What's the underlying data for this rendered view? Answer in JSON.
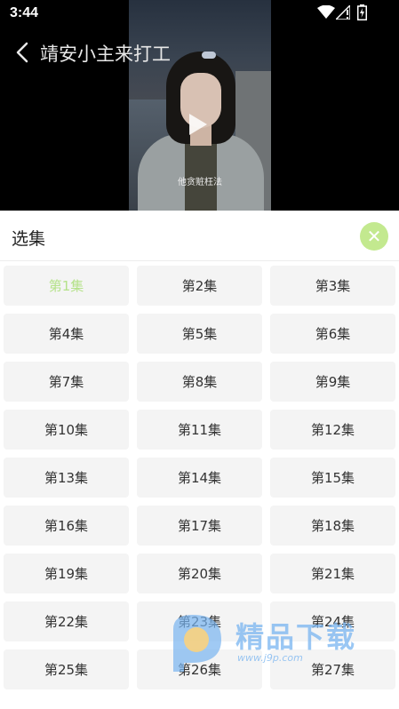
{
  "status_bar": {
    "time": "3:44"
  },
  "header": {
    "title": "靖安小主来打工"
  },
  "video": {
    "subtitle": "他贪赃枉法"
  },
  "panel": {
    "title": "选集",
    "close_symbol": "✕",
    "active_index": 0,
    "episodes": [
      "第1集",
      "第2集",
      "第3集",
      "第4集",
      "第5集",
      "第6集",
      "第7集",
      "第8集",
      "第9集",
      "第10集",
      "第11集",
      "第12集",
      "第13集",
      "第14集",
      "第15集",
      "第16集",
      "第17集",
      "第18集",
      "第19集",
      "第20集",
      "第21集",
      "第22集",
      "第23集",
      "第24集",
      "第25集",
      "第26集",
      "第27集"
    ]
  },
  "watermark": {
    "text": "精品下载",
    "url": "www.j9p.com"
  },
  "colors": {
    "accent": "#b5e28a",
    "close_bg": "#c3e98f",
    "tile_bg": "#f4f4f4",
    "watermark": "#78b4f0"
  }
}
